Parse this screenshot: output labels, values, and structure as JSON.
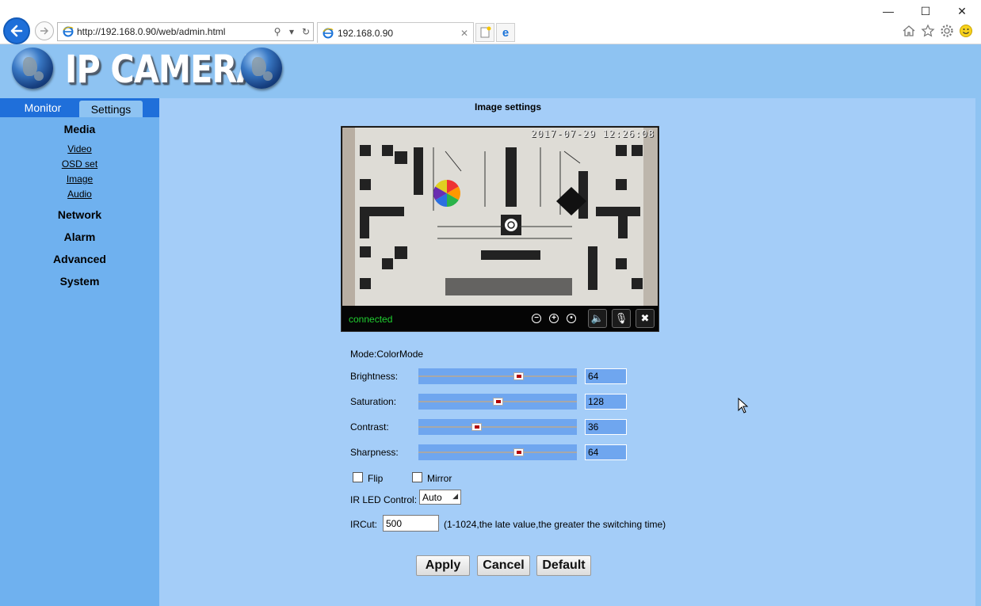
{
  "browser": {
    "url": "http://192.168.0.90/web/admin.html",
    "tab_title": "192.168.0.90",
    "window_controls": {
      "minimize": "—",
      "maximize": "☐",
      "close": "✕"
    }
  },
  "banner": {
    "logo_text": "IP CAMERA"
  },
  "sidebar": {
    "tabs": {
      "monitor": "Monitor",
      "settings": "Settings"
    },
    "sections": {
      "media": "Media",
      "network": "Network",
      "alarm": "Alarm",
      "advanced": "Advanced",
      "system": "System"
    },
    "media_links": {
      "video": "Video",
      "osd": "OSD set",
      "image": "Image",
      "audio": "Audio"
    }
  },
  "content": {
    "title": "Image settings",
    "video": {
      "timestamp": "2017-07-29  12:26:08",
      "status": "connected"
    },
    "mode": "Mode:ColorMode",
    "sliders": {
      "brightness": {
        "label": "Brightness:",
        "value": "64",
        "fraction": 0.64
      },
      "saturation": {
        "label": "Saturation:",
        "value": "128",
        "fraction": 0.5
      },
      "contrast": {
        "label": "Contrast:",
        "value": "36",
        "fraction": 0.36
      },
      "sharpness": {
        "label": "Sharpness:",
        "value": "64",
        "fraction": 0.64
      }
    },
    "flip_label": "Flip",
    "mirror_label": "Mirror",
    "ir_led": {
      "label": "IR LED Control:",
      "value": "Auto"
    },
    "ircut": {
      "label": "IRCut:",
      "value": "500",
      "hint": "(1-1024,the late value,the greater the switching time)"
    },
    "buttons": {
      "apply": "Apply",
      "cancel": "Cancel",
      "default": "Default"
    }
  },
  "colors": {
    "page_bg": "#8ec3f2",
    "content_bg": "#a4cdf8",
    "sidebar_bg": "#6fb1ef",
    "tab_bar": "#1f6fda",
    "status_green": "#20d030"
  }
}
